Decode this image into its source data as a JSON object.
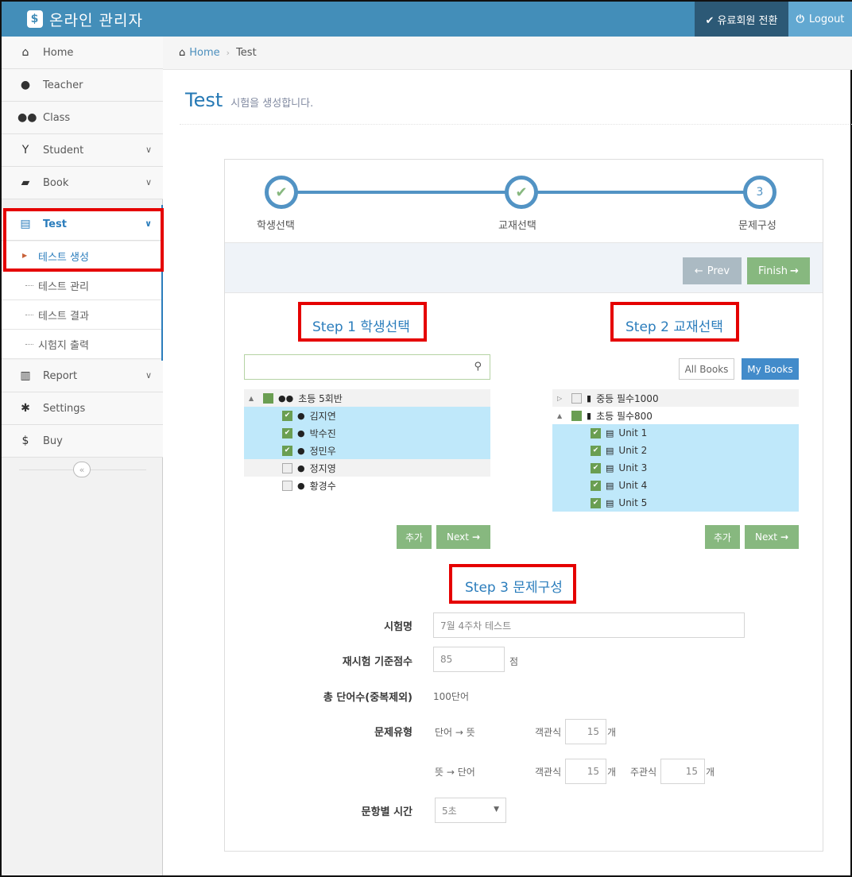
{
  "app": {
    "title": "온라인 관리자",
    "logo_char": "&",
    "premium_label": "✔ 유료회원 전환",
    "logout_label": "Logout"
  },
  "sidebar": {
    "items": [
      {
        "label": "Home",
        "icon": "home-icon"
      },
      {
        "label": "Teacher",
        "icon": "user-icon"
      },
      {
        "label": "Class",
        "icon": "group-icon"
      },
      {
        "label": "Student",
        "icon": "child-icon"
      },
      {
        "label": "Book",
        "icon": "book-icon"
      },
      {
        "label": "Test",
        "icon": "list-icon"
      },
      {
        "label": "Report",
        "icon": "bar-chart-icon"
      },
      {
        "label": "Settings",
        "icon": "gear-icon"
      },
      {
        "label": "Buy",
        "icon": "dollar-icon"
      }
    ],
    "test_sub": [
      "테스트 생성",
      "테스트 관리",
      "테스트 결과",
      "시험지 출력"
    ]
  },
  "breadcrumb": {
    "home": "Home",
    "current": "Test"
  },
  "page": {
    "title": "Test",
    "subtitle": "시험을 생성합니다."
  },
  "wizard": {
    "steps": [
      "학생선택",
      "교재선택",
      "문제구성"
    ],
    "step3_num": "3",
    "prev": "Prev",
    "finish": "Finish"
  },
  "step1": {
    "title": "Step 1 학생선택",
    "group": "초등 5회반",
    "students": [
      {
        "name": "김지연",
        "checked": true
      },
      {
        "name": "박수진",
        "checked": true
      },
      {
        "name": "정민우",
        "checked": true
      },
      {
        "name": "정지영",
        "checked": false
      },
      {
        "name": "황경수",
        "checked": false
      }
    ],
    "add": "추가",
    "next": "Next"
  },
  "step2": {
    "title": "Step 2 교재선택",
    "tab_all": "All Books",
    "tab_my": "My Books",
    "books": [
      {
        "name": "중등 필수1000",
        "checked": false
      },
      {
        "name": "초등 필수800",
        "checked": true
      }
    ],
    "units": [
      "Unit 1",
      "Unit 2",
      "Unit 3",
      "Unit 4",
      "Unit 5"
    ],
    "add": "추가",
    "next": "Next"
  },
  "step3": {
    "title": "Step 3 문제구성",
    "test_name_label": "시험명",
    "test_name_value": "7월 4주차 테스트",
    "retest_label": "재시험 기준점수",
    "retest_value": "85",
    "retest_unit": "점",
    "total_label": "총 단어수(중복제외)",
    "total_value": "100단어",
    "type_label": "문제유형",
    "type1": "단어 → 뜻",
    "type2": "뜻 → 단어",
    "objective": "객관식",
    "subjective": "주관식",
    "count_unit": "개",
    "type1_obj": "15",
    "type2_obj": "15",
    "type2_subj": "15",
    "time_label": "문항별 시간",
    "time_value": "5초"
  },
  "colors": {
    "topbar": "#438eb9",
    "primary": "#2b7dbc",
    "green": "#87b87f",
    "highlight": "#e50000"
  }
}
